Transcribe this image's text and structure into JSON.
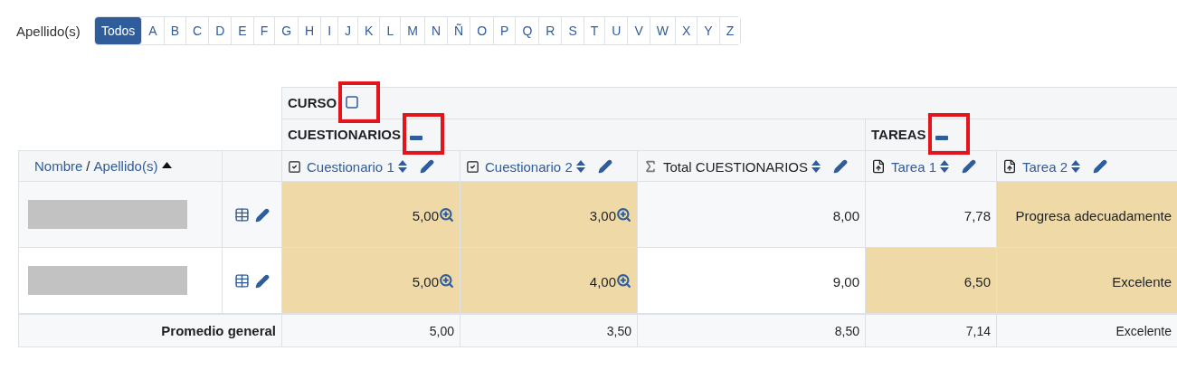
{
  "filter": {
    "label": "Apellido(s)",
    "letters": [
      {
        "label": "Todos",
        "selected": true
      },
      {
        "label": "A",
        "selected": false
      },
      {
        "label": "B",
        "selected": false
      },
      {
        "label": "C",
        "selected": false
      },
      {
        "label": "D",
        "selected": false
      },
      {
        "label": "E",
        "selected": false
      },
      {
        "label": "F",
        "selected": false
      },
      {
        "label": "G",
        "selected": false
      },
      {
        "label": "H",
        "selected": false
      },
      {
        "label": "I",
        "selected": false
      },
      {
        "label": "J",
        "selected": false
      },
      {
        "label": "K",
        "selected": false
      },
      {
        "label": "L",
        "selected": false
      },
      {
        "label": "M",
        "selected": false
      },
      {
        "label": "N",
        "selected": false
      },
      {
        "label": "Ñ",
        "selected": false
      },
      {
        "label": "O",
        "selected": false
      },
      {
        "label": "P",
        "selected": false
      },
      {
        "label": "Q",
        "selected": false
      },
      {
        "label": "R",
        "selected": false
      },
      {
        "label": "S",
        "selected": false
      },
      {
        "label": "T",
        "selected": false
      },
      {
        "label": "U",
        "selected": false
      },
      {
        "label": "V",
        "selected": false
      },
      {
        "label": "W",
        "selected": false
      },
      {
        "label": "X",
        "selected": false
      },
      {
        "label": "Y",
        "selected": false
      },
      {
        "label": "Z",
        "selected": false
      }
    ]
  },
  "course": {
    "name": "CURSO",
    "expanded": false,
    "marked": true
  },
  "categories": [
    {
      "name": "CUESTIONARIOS",
      "expanded": true,
      "marked": true,
      "columns": [
        {
          "kind": "quiz",
          "label": "Cuestionario 1"
        },
        {
          "kind": "quiz",
          "label": "Cuestionario 2"
        },
        {
          "kind": "total",
          "label": "Total CUESTIONARIOS"
        }
      ]
    },
    {
      "name": "TAREAS",
      "expanded": true,
      "marked": true,
      "columns": [
        {
          "kind": "assignment",
          "label": "Tarea 1"
        },
        {
          "kind": "assignment",
          "label": "Tarea 2"
        }
      ]
    }
  ],
  "name_header": {
    "first": "Nombre",
    "separator": "/",
    "last": "Apellido(s)",
    "sorted_ascending": true
  },
  "rows": [
    {
      "grades": [
        {
          "value": "5,00",
          "overridden": true,
          "zoom": true
        },
        {
          "value": "3,00",
          "overridden": true,
          "zoom": true
        },
        {
          "value": "8,00",
          "overridden": false,
          "zoom": false
        },
        {
          "value": "7,78",
          "overridden": false,
          "zoom": false
        },
        {
          "value": "Progresa adecuadamente",
          "overridden": true,
          "zoom": false
        }
      ]
    },
    {
      "grades": [
        {
          "value": "5,00",
          "overridden": true,
          "zoom": true
        },
        {
          "value": "4,00",
          "overridden": true,
          "zoom": true
        },
        {
          "value": "9,00",
          "overridden": false,
          "zoom": false
        },
        {
          "value": "6,50",
          "overridden": true,
          "zoom": false
        },
        {
          "value": "Excelente",
          "overridden": true,
          "zoom": false
        }
      ]
    }
  ],
  "average": {
    "label": "Promedio general",
    "values": [
      "5,00",
      "3,50",
      "8,50",
      "7,14",
      "Excelente"
    ]
  }
}
